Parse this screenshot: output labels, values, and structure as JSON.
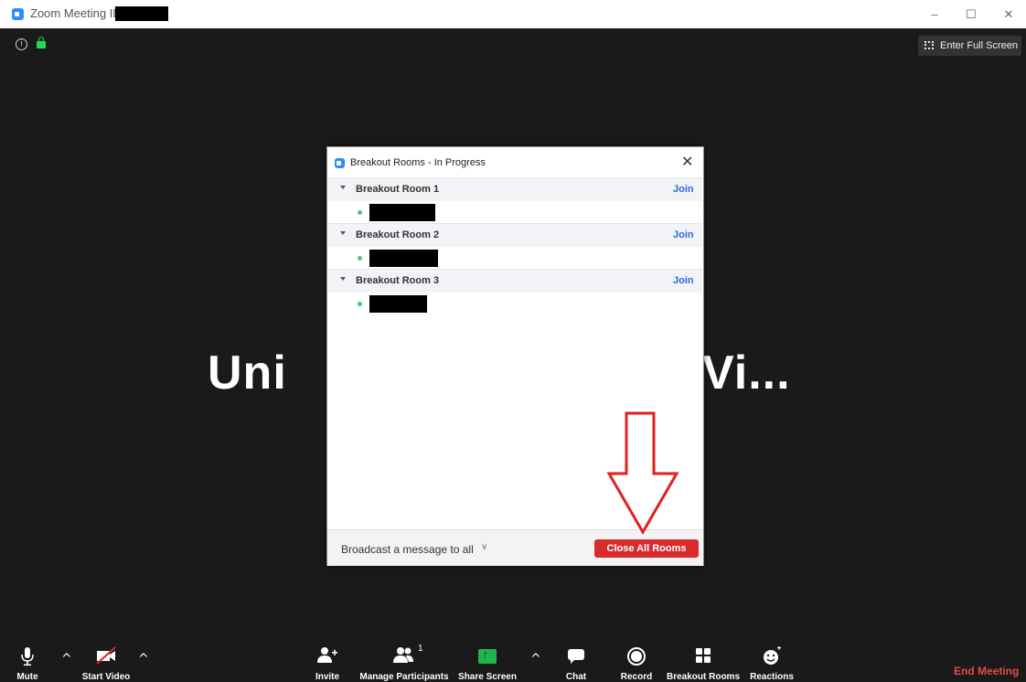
{
  "window": {
    "title": "Zoom Meeting ID:",
    "min_symbol": "–",
    "max_symbol": "☐",
    "close_symbol": "✕"
  },
  "meeting": {
    "fullscreen_label": "Enter Full Screen",
    "bg_text_left": "Uni",
    "bg_text_right": "Vi..."
  },
  "dialog": {
    "title": "Breakout Rooms - In Progress",
    "rooms": [
      {
        "name": "Breakout Room 1",
        "join": "Join"
      },
      {
        "name": "Breakout Room 2",
        "join": "Join"
      },
      {
        "name": "Breakout Room 3",
        "join": "Join"
      }
    ],
    "broadcast_label": "Broadcast a message to all",
    "close_all_label": "Close All Rooms",
    "close_all_color": "#d92b2b"
  },
  "toolbar": {
    "mute": "Mute",
    "start_video": "Start Video",
    "invite": "Invite",
    "manage_participants": "Manage Participants",
    "participant_count": "1",
    "share_screen": "Share Screen",
    "chat": "Chat",
    "record": "Record",
    "breakout_rooms": "Breakout Rooms",
    "reactions": "Reactions",
    "end_meeting": "End Meeting"
  },
  "colors": {
    "accent": "#2d8cff",
    "end_meeting": "#e54848",
    "share_screen_green": "#1fb54c",
    "annotation_arrow": "#e02020"
  }
}
